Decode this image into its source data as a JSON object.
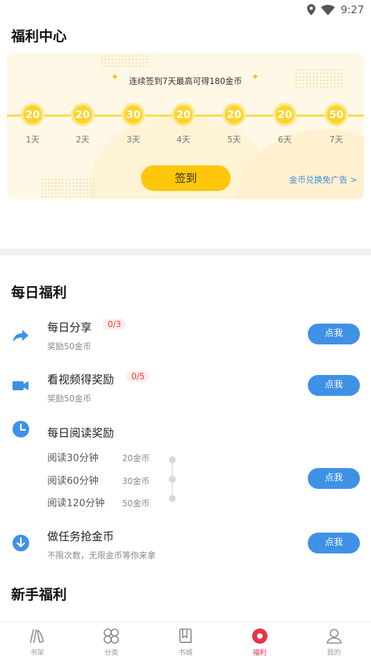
{
  "status_bar": {
    "time": "9:27"
  },
  "page_title": "福利中心",
  "signin": {
    "tip": "连续签到7天最高可得180金币",
    "days": [
      {
        "coins": "20",
        "label": "1天"
      },
      {
        "coins": "20",
        "label": "2天"
      },
      {
        "coins": "30",
        "label": "3天"
      },
      {
        "coins": "20",
        "label": "4天"
      },
      {
        "coins": "20",
        "label": "5天"
      },
      {
        "coins": "20",
        "label": "6天"
      },
      {
        "coins": "50",
        "label": "7天"
      }
    ],
    "button_label": "签到",
    "redeem_link": "金币兑换免广告 >"
  },
  "daily": {
    "title": "每日福利",
    "go_label": "点我",
    "tasks": [
      {
        "title": "每日分享",
        "badge": "0/3",
        "sub": "奖励50金币",
        "icon": "share-arrow-icon"
      },
      {
        "title": "看视频得奖励",
        "badge": "0/5",
        "sub": "奖励50金币",
        "icon": "video-camera-icon"
      },
      {
        "title": "每日阅读奖励",
        "icon": "clock-icon",
        "rows": [
          {
            "label": "阅读30分钟",
            "coins": "20金币"
          },
          {
            "label": "阅读60分钟",
            "coins": "30金币"
          },
          {
            "label": "阅读120分钟",
            "coins": "50金币"
          }
        ]
      },
      {
        "title": "做任务抢金币",
        "sub": "不限次数，无限金币等你来拿",
        "icon": "download-arrow-icon"
      }
    ]
  },
  "newbie": {
    "title": "新手福利"
  },
  "tabbar": {
    "items": [
      {
        "label": "书架",
        "icon": "bookshelf-icon"
      },
      {
        "label": "分类",
        "icon": "category-icon"
      },
      {
        "label": "书城",
        "icon": "bookstore-icon"
      },
      {
        "label": "福利",
        "icon": "welfare-icon",
        "active": true
      },
      {
        "label": "我的",
        "icon": "profile-icon"
      }
    ]
  },
  "colors": {
    "accent": "#ffc60c",
    "button_blue": "#3f91e6",
    "active_tab": "#e8334a",
    "badge_red": "#ef3e3e"
  }
}
